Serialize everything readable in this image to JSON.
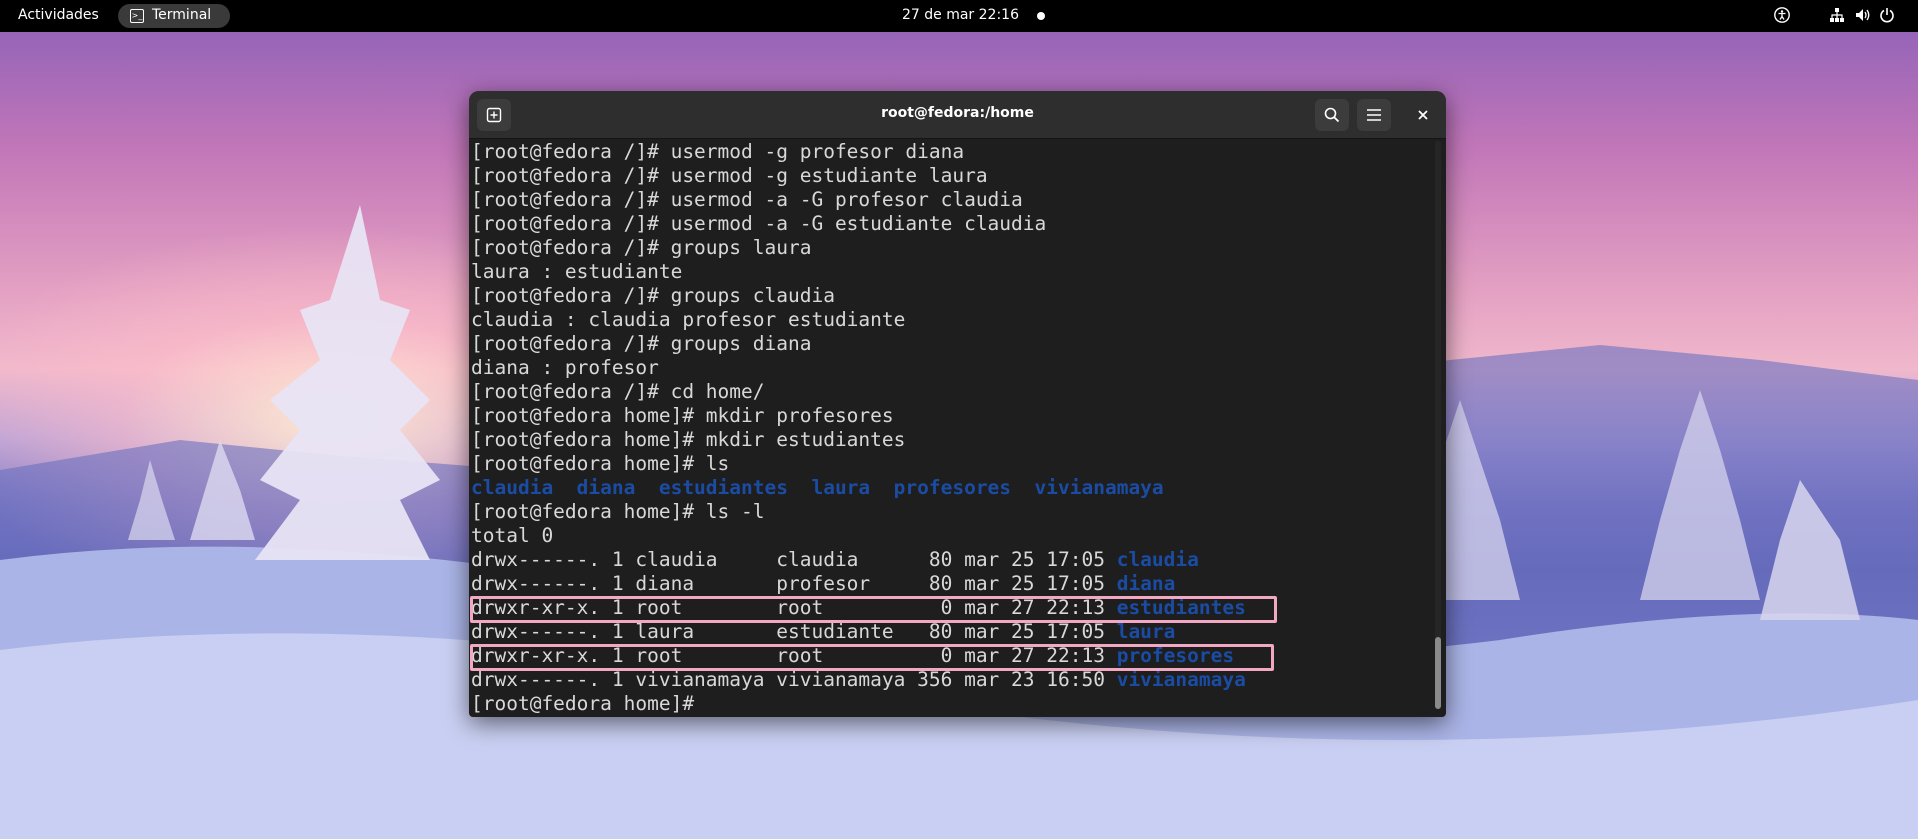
{
  "topbar": {
    "activities": "Actividades",
    "app_name": "Terminal",
    "clock": "27 de mar  22:16"
  },
  "window": {
    "title": "root@fedora:/home"
  },
  "terminal": {
    "lines": [
      {
        "text": "[root@fedora /]# usermod -g profesor diana"
      },
      {
        "text": "[root@fedora /]# usermod -g estudiante laura"
      },
      {
        "text": "[root@fedora /]# usermod -a -G profesor claudia"
      },
      {
        "text": "[root@fedora /]# usermod -a -G estudiante claudia"
      },
      {
        "text": "[root@fedora /]# groups laura"
      },
      {
        "text": "laura : estudiante"
      },
      {
        "text": "[root@fedora /]# groups claudia"
      },
      {
        "text": "claudia : claudia profesor estudiante"
      },
      {
        "text": "[root@fedora /]# groups diana"
      },
      {
        "text": "diana : profesor"
      },
      {
        "text": "[root@fedora /]# cd home/"
      },
      {
        "text": "[root@fedora home]# mkdir profesores"
      },
      {
        "text": "[root@fedora home]# mkdir estudiantes"
      },
      {
        "text": "[root@fedora home]# ls"
      },
      {
        "text": "",
        "dir": "claudia  diana  estudiantes  laura  profesores  vivianamaya"
      },
      {
        "text": "[root@fedora home]# ls -l"
      },
      {
        "text": "total 0"
      },
      {
        "text": "drwx------. 1 claudia     claudia      80 mar 25 17:05 ",
        "dir": "claudia"
      },
      {
        "text": "drwx------. 1 diana       profesor     80 mar 25 17:05 ",
        "dir": "diana"
      },
      {
        "text": "drwxr-xr-x. 1 root        root          0 mar 27 22:13 ",
        "dir": "estudiantes"
      },
      {
        "text": "drwx------. 1 laura       estudiante   80 mar 25 17:05 ",
        "dir": "laura"
      },
      {
        "text": "drwxr-xr-x. 1 root        root          0 mar 27 22:13 ",
        "dir": "profesores"
      },
      {
        "text": "drwx------. 1 vivianamaya vivianamaya 356 mar 23 16:50 ",
        "dir": "vivianamaya"
      },
      {
        "text": "[root@fedora home]# "
      }
    ]
  },
  "icons": {
    "new_tab": "new-tab-icon",
    "search": "search-icon",
    "menu": "hamburger-menu-icon",
    "close": "close-icon",
    "accessibility": "accessibility-icon",
    "network": "network-icon",
    "volume": "volume-icon",
    "power": "power-icon"
  },
  "colors": {
    "directory": "#1b4ca3",
    "highlight_box": "#f2a7c2",
    "terminal_bg": "#1e1e1e",
    "terminal_fg": "#d8d8d8"
  }
}
